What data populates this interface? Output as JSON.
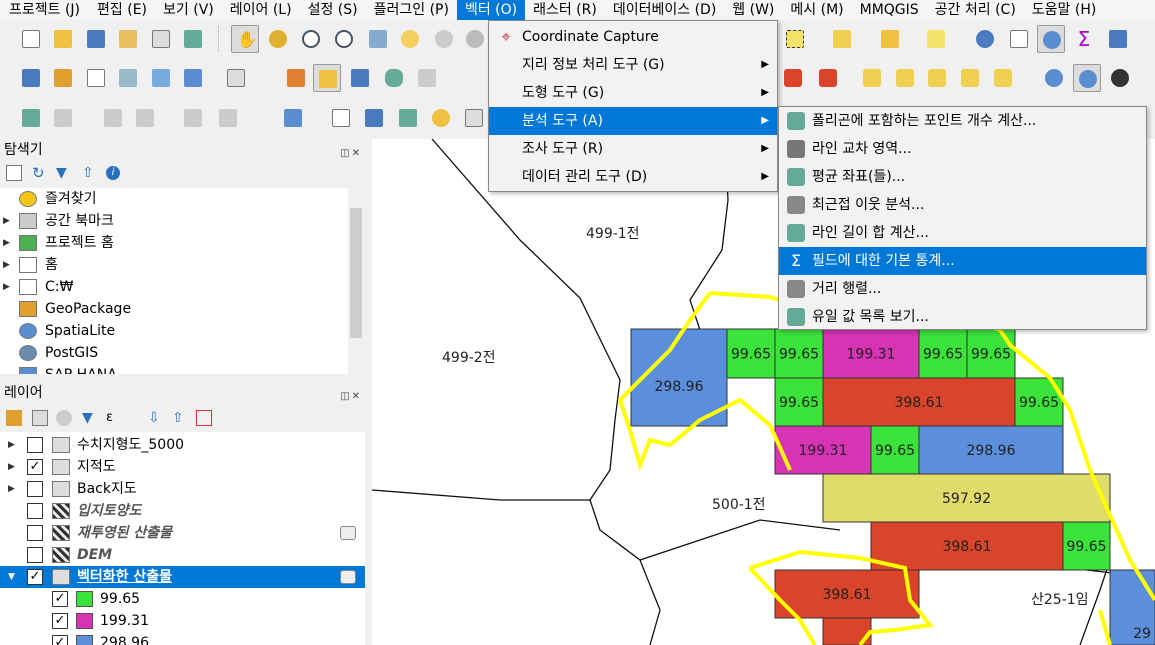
{
  "menubar": {
    "items": [
      "프로젝트 (J)",
      "편집 (E)",
      "보기 (V)",
      "레이어 (L)",
      "설정 (S)",
      "플러그인 (P)",
      "벡터 (O)",
      "래스터 (R)",
      "데이터베이스 (D)",
      "웹 (W)",
      "메시 (M)",
      "MMQGIS",
      "공간 처리 (C)",
      "도움말 (H)"
    ],
    "active_index": 6
  },
  "vector_menu": {
    "items": [
      {
        "label": "Coordinate Capture",
        "icon": "crosshair-icon",
        "submenu": false
      },
      {
        "label": "지리 정보 처리 도구 (G)",
        "submenu": true
      },
      {
        "label": "도형 도구 (G)",
        "submenu": true
      },
      {
        "label": "분석 도구 (A)",
        "submenu": true,
        "highlighted": true
      },
      {
        "label": "조사 도구 (R)",
        "submenu": true
      },
      {
        "label": "데이터 관리 도구 (D)",
        "submenu": true
      }
    ]
  },
  "analysis_menu": {
    "items": [
      {
        "label": "폴리곤에 포함하는 포인트 개수 계산...",
        "icon": "count-points-icon"
      },
      {
        "label": "라인 교차 영역...",
        "icon": "line-intersection-icon"
      },
      {
        "label": "평균 좌표(들)...",
        "icon": "mean-coordinates-icon"
      },
      {
        "label": "최근접 이웃 분석...",
        "icon": "nearest-neighbour-icon"
      },
      {
        "label": "라인 길이 합 계산...",
        "icon": "sum-line-length-icon"
      },
      {
        "label": "필드에 대한 기본 통계...",
        "icon": "sigma-icon",
        "highlighted": true
      },
      {
        "label": "거리 행렬...",
        "icon": "distance-matrix-icon"
      },
      {
        "label": "유일 값 목록 보기...",
        "icon": "unique-values-icon"
      }
    ]
  },
  "browser_panel": {
    "title": "탐색기",
    "items": [
      {
        "label": "즐겨찾기",
        "icon": "star-icon",
        "expand": false
      },
      {
        "label": "공간 북마크",
        "icon": "bookmark-icon",
        "expand": true
      },
      {
        "label": "프로젝트 홈",
        "icon": "project-home-icon",
        "expand": true
      },
      {
        "label": "홈",
        "icon": "home-icon",
        "expand": true
      },
      {
        "label": "C:₩",
        "icon": "folder-icon",
        "expand": true
      },
      {
        "label": "GeoPackage",
        "icon": "geopackage-icon",
        "expand": false
      },
      {
        "label": "SpatiaLite",
        "icon": "spatialite-icon",
        "expand": false
      },
      {
        "label": "PostGIS",
        "icon": "postgis-icon",
        "expand": false
      },
      {
        "label": "SAP HANA",
        "icon": "database-icon",
        "expand": false
      }
    ]
  },
  "layers_panel": {
    "title": "레이어",
    "layers": [
      {
        "label": "수치지형도_5000",
        "checked": false,
        "expand": true,
        "style": "normal"
      },
      {
        "label": "지적도",
        "checked": true,
        "expand": true,
        "style": "normal"
      },
      {
        "label": "Back지도",
        "checked": false,
        "expand": true,
        "style": "normal"
      },
      {
        "label": "입지토양도",
        "checked": false,
        "expand": false,
        "style": "italic"
      },
      {
        "label": "재투영된 산출물",
        "checked": false,
        "expand": false,
        "style": "italic"
      },
      {
        "label": "DEM",
        "checked": false,
        "expand": false,
        "style": "italic"
      },
      {
        "label": "벡터화한 산출물",
        "checked": true,
        "expand": true,
        "style": "selected"
      }
    ],
    "legend": [
      {
        "label": "99.65",
        "color": "#3ae23a",
        "checked": true
      },
      {
        "label": "199.31",
        "color": "#d633b5",
        "checked": true
      },
      {
        "label": "298.96",
        "color": "#5b8fdc",
        "checked": true
      }
    ]
  },
  "map": {
    "parcel_labels": [
      "499-1전",
      "499-2전",
      "500-1전",
      "산25-1임"
    ],
    "cell_values": {
      "green": "99.65",
      "magenta": "199.31",
      "blue": "298.96",
      "red": "398.61",
      "khaki": "597.92",
      "blue_partial": "29"
    },
    "colors": {
      "green": "#3ae23a",
      "magenta": "#d633b5",
      "blue": "#5b8fdc",
      "red": "#d9442b",
      "khaki": "#e0dc6a",
      "boundary": "#ffff00"
    }
  }
}
